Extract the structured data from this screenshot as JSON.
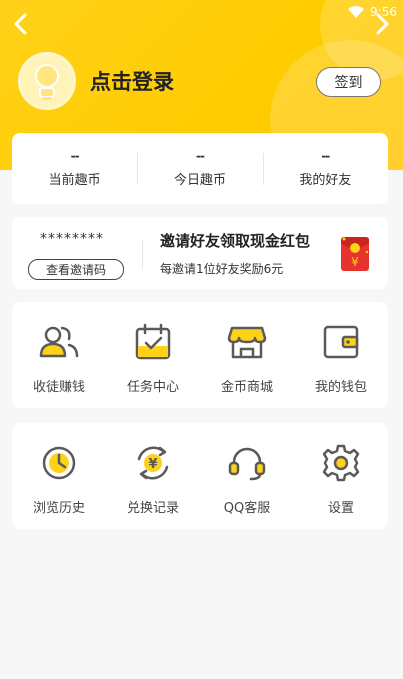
{
  "status_bar": {
    "time": "9:56"
  },
  "profile": {
    "login_text": "点击登录",
    "signin_label": "签到"
  },
  "stats": [
    {
      "value": "--",
      "label": "当前趣币"
    },
    {
      "value": "--",
      "label": "今日趣币"
    },
    {
      "value": "--",
      "label": "我的好友"
    }
  ],
  "invite": {
    "code": "********",
    "view_button": "查看邀请码",
    "title": "邀请好友领取现金红包",
    "subtitle": "每邀请1位好友奖励6元"
  },
  "menu_row1": [
    {
      "label": "收徒赚钱",
      "icon": "friends-icon"
    },
    {
      "label": "任务中心",
      "icon": "calendar-check-icon"
    },
    {
      "label": "金币商城",
      "icon": "shop-icon"
    },
    {
      "label": "我的钱包",
      "icon": "wallet-icon"
    }
  ],
  "menu_row2": [
    {
      "label": "浏览历史",
      "icon": "history-clock-icon"
    },
    {
      "label": "兑换记录",
      "icon": "exchange-yuan-icon"
    },
    {
      "label": "QQ客服",
      "icon": "headset-icon"
    },
    {
      "label": "设置",
      "icon": "gear-icon"
    }
  ],
  "colors": {
    "accent": "#ffcc00",
    "icon_stroke": "#5a5a5a",
    "icon_fill": "#ffd21a",
    "envelope_red": "#e8322d"
  }
}
